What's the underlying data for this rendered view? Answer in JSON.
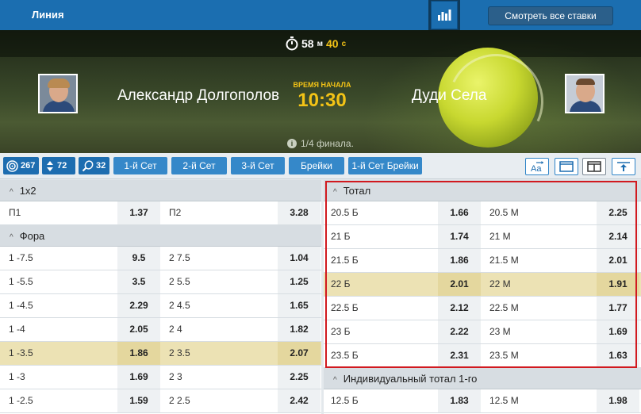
{
  "header": {
    "title": "Линия",
    "see_all": "Смотреть все ставки"
  },
  "match": {
    "timer_min": "58",
    "timer_min_unit": "м",
    "timer_sec": "40",
    "timer_sec_unit": "с",
    "player1": "Александр Долгополов",
    "player2": "Дуди Села",
    "start_label": "ВРЕМЯ НАЧАЛА",
    "start_time": "10:30",
    "round": "1/4 финала."
  },
  "filters": {
    "stats": [
      {
        "icon": "target-icon",
        "value": "267"
      },
      {
        "icon": "updown-icon",
        "value": "72"
      },
      {
        "icon": "racket-icon",
        "value": "32"
      }
    ],
    "tabs": [
      "1-й Сет",
      "2-й Сет",
      "3-й Сет",
      "Брейки",
      "1-й Сет Брейки"
    ],
    "tools": [
      "font-size-icon",
      "single-column-icon",
      "two-column-icon",
      "scroll-top-icon"
    ]
  },
  "left": {
    "sections": [
      {
        "title": "1х2",
        "rows": [
          {
            "l1": "П1",
            "o1": "1.37",
            "l2": "П2",
            "o2": "3.28",
            "hl": false
          }
        ]
      },
      {
        "title": "Фора",
        "rows": [
          {
            "l1": "1 -7.5",
            "o1": "9.5",
            "l2": "2 7.5",
            "o2": "1.04",
            "hl": false
          },
          {
            "l1": "1 -5.5",
            "o1": "3.5",
            "l2": "2 5.5",
            "o2": "1.25",
            "hl": false
          },
          {
            "l1": "1 -4.5",
            "o1": "2.29",
            "l2": "2 4.5",
            "o2": "1.65",
            "hl": false
          },
          {
            "l1": "1 -4",
            "o1": "2.05",
            "l2": "2 4",
            "o2": "1.82",
            "hl": false
          },
          {
            "l1": "1 -3.5",
            "o1": "1.86",
            "l2": "2 3.5",
            "o2": "2.07",
            "hl": true
          },
          {
            "l1": "1 -3",
            "o1": "1.69",
            "l2": "2 3",
            "o2": "2.25",
            "hl": false
          },
          {
            "l1": "1 -2.5",
            "o1": "1.59",
            "l2": "2 2.5",
            "o2": "2.42",
            "hl": false
          }
        ]
      }
    ]
  },
  "right": {
    "sections": [
      {
        "title": "Тотал",
        "rows": [
          {
            "l1": "20.5 Б",
            "o1": "1.66",
            "l2": "20.5 М",
            "o2": "2.25",
            "hl": false
          },
          {
            "l1": "21 Б",
            "o1": "1.74",
            "l2": "21 М",
            "o2": "2.14",
            "hl": false
          },
          {
            "l1": "21.5 Б",
            "o1": "1.86",
            "l2": "21.5 М",
            "o2": "2.01",
            "hl": false
          },
          {
            "l1": "22 Б",
            "o1": "2.01",
            "l2": "22 М",
            "o2": "1.91",
            "hl": true
          },
          {
            "l1": "22.5 Б",
            "o1": "2.12",
            "l2": "22.5 М",
            "o2": "1.77",
            "hl": false
          },
          {
            "l1": "23 Б",
            "o1": "2.22",
            "l2": "23 М",
            "o2": "1.69",
            "hl": false
          },
          {
            "l1": "23.5 Б",
            "o1": "2.31",
            "l2": "23.5 М",
            "o2": "1.63",
            "hl": false
          }
        ]
      },
      {
        "title": "Индивидуальный тотал 1-го",
        "rows": [
          {
            "l1": "12.5 Б",
            "o1": "1.83",
            "l2": "12.5 М",
            "o2": "1.98",
            "hl": false
          }
        ]
      }
    ]
  },
  "colors": {
    "header_blue": "#1b6eb0",
    "accent_yellow": "#f3c316",
    "highlight_row": "#ece2b4",
    "selection_red": "#d1191f"
  }
}
